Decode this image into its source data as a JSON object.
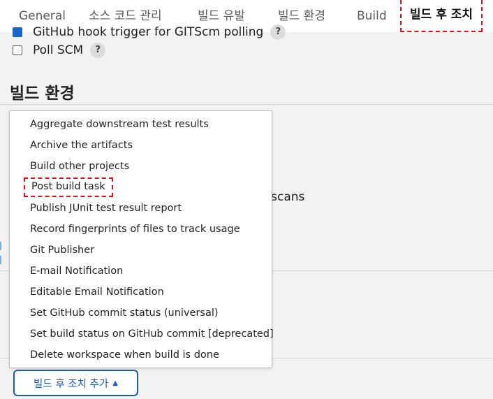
{
  "tabs": [
    {
      "label": "General"
    },
    {
      "label": "소스 코드 관리"
    },
    {
      "label": "빌드 유발"
    },
    {
      "label": "빌드 환경"
    },
    {
      "label": "Build"
    },
    {
      "label": "빌드 후 조치",
      "active": true
    }
  ],
  "triggers": {
    "github_hook": {
      "label": "GitHub hook trigger for GITScm polling",
      "checked": true
    },
    "poll_scm": {
      "label": "Poll SCM",
      "checked": false
    },
    "help_icon": "?"
  },
  "build_env": {
    "title": "빌드 환경",
    "partial_text": "l scans"
  },
  "dropdown": {
    "items": [
      "Aggregate downstream test results",
      "Archive the artifacts",
      "Build other projects",
      "Post build task",
      "Publish JUnit test result report",
      "Record fingerprints of files to track usage",
      "Git Publisher",
      "E-mail Notification",
      "Editable Email Notification",
      "Set GitHub commit status (universal)",
      "Set build status on GitHub commit [deprecated]",
      "Delete workspace when build is done"
    ],
    "highlighted_item": "Post build task"
  },
  "add_button": {
    "label": "빌드 후 조치 추가",
    "caret": "▲"
  },
  "colors": {
    "accent": "#1a5bb5",
    "highlight": "#e0101a",
    "checkbox": "#1a66c8"
  }
}
